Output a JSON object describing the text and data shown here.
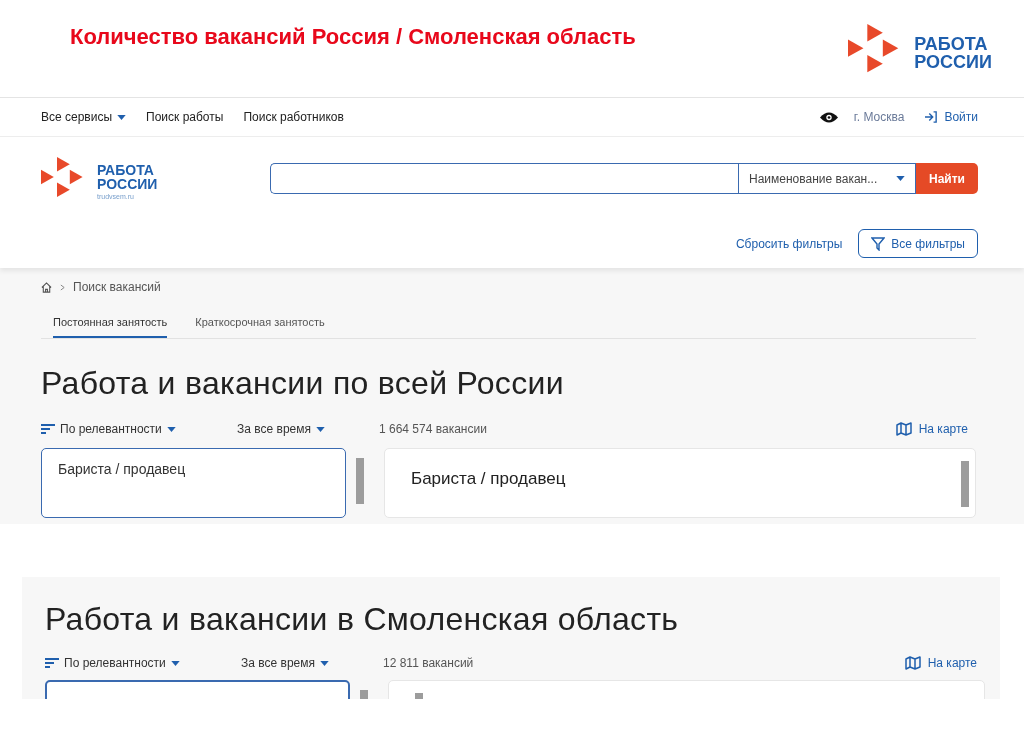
{
  "slide_title": "Количество вакансий Россия / Смоленская область",
  "slide_logo": {
    "line1": "РАБОТА",
    "line2": "РОССИИ"
  },
  "top_nav": {
    "items": [
      {
        "label": "Все сервисы",
        "dropdown": true
      },
      {
        "label": "Поиск работы",
        "dropdown": false
      },
      {
        "label": "Поиск работников",
        "dropdown": false
      }
    ],
    "city": "г. Москва",
    "login": "Войти"
  },
  "site_header": {
    "logo": {
      "line1": "РАБОТА",
      "line2": "РОССИИ",
      "domain": "trudvsem.ru"
    },
    "search_type": "Наименование вакан...",
    "search_button": "Найти",
    "reset_filters": "Сбросить фильтры",
    "all_filters": "Все фильтры"
  },
  "breadcrumb": {
    "current": "Поиск вакансий"
  },
  "tabs": [
    {
      "label": "Постоянная занятость",
      "selected": true
    },
    {
      "label": "Краткосрочная занятость",
      "selected": false
    }
  ],
  "results_russia": {
    "heading": "Работа и вакансии по всей России",
    "sort": "По релевантности",
    "period": "За все время",
    "count": "1 664 574 вакансии",
    "map_link": "На карте",
    "list_card_title": "Бариста / продавец",
    "detail_title": "Бариста / продавец"
  },
  "results_smolensk": {
    "heading": "Работа и вакансии в Смоленская область",
    "sort": "По релевантности",
    "period": "За все время",
    "count": "12 811 вакансий",
    "map_link": "На карте"
  }
}
